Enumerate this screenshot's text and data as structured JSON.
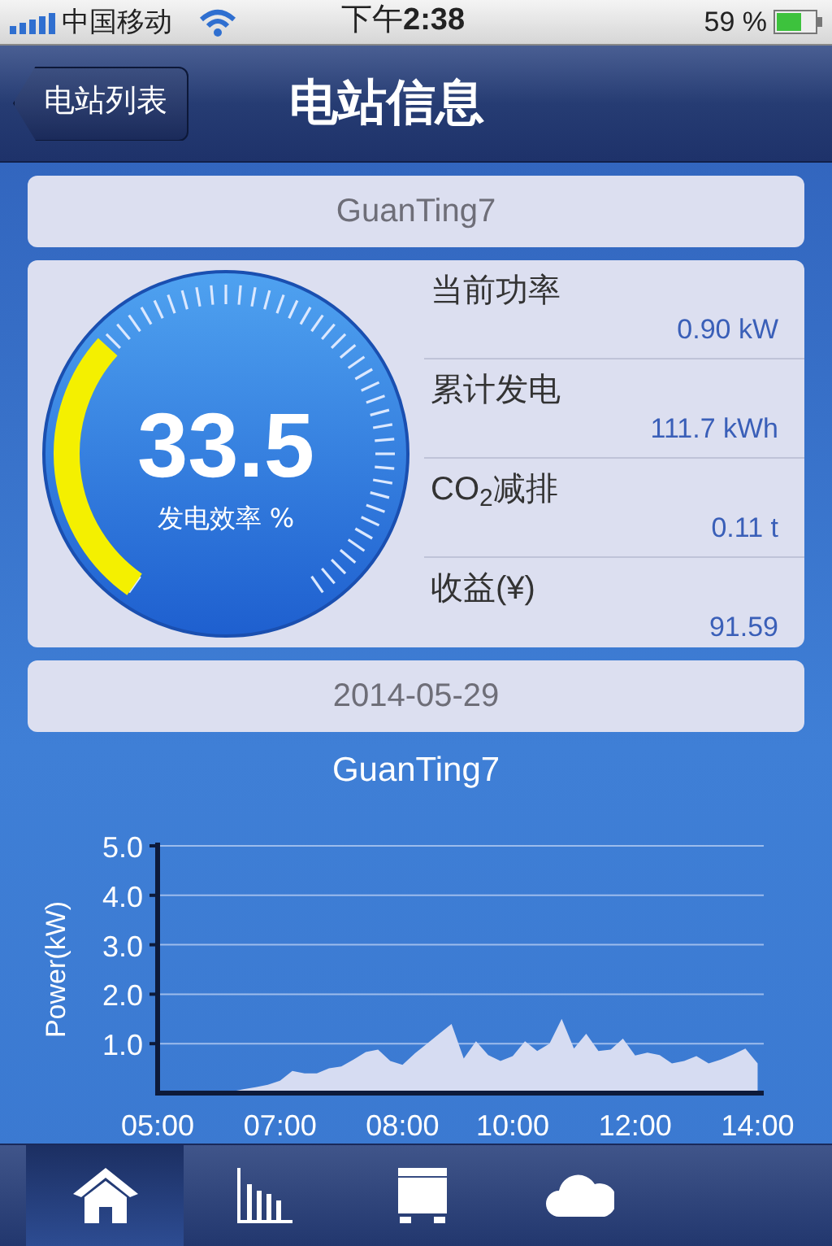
{
  "status_bar": {
    "carrier": "中国移动",
    "time": "下午**2:38**",
    "battery": "59 %"
  },
  "nav_bar": {
    "back": "电站列表",
    "title": "电站信息"
  },
  "station_name": "GuanTing7",
  "gauge": {
    "value": "33.5",
    "label": "发电效率 %"
  },
  "stats": [
    {
      "label": "当前功率",
      "value": "0.90 kW"
    },
    {
      "label": "累计发电",
      "value": "111.7 kWh"
    },
    {
      "label": "CO$_{2}$减排",
      "value": "0.11 t"
    },
    {
      "label": "收益(¥)",
      "value": "91.59"
    }
  ],
  "date": "2014-05-29",
  "chart": {
    "chart_data": {
      "type": "area",
      "title": "GuanTing7",
      "ylabel": "Power(kW)",
      "grid": true,
      "ylim": [
        0,
        5
      ],
      "yticks": [
        {
          "value": 1,
          "label": "1.0"
        },
        {
          "value": 2,
          "label": "2.0"
        },
        {
          "value": 3,
          "label": "3.0"
        },
        {
          "value": 4,
          "label": "4.0"
        },
        {
          "value": 5,
          "label": "5.0"
        }
      ],
      "categories": [
        "05:00",
        null,
        null,
        null,
        null,
        null,
        null,
        null,
        null,
        null,
        "07:00",
        null,
        null,
        null,
        null,
        null,
        null,
        null,
        null,
        null,
        "08:00",
        null,
        null,
        null,
        null,
        null,
        null,
        null,
        null,
        "10:00",
        null,
        null,
        null,
        null,
        null,
        null,
        null,
        null,
        null,
        "12:00",
        null,
        null,
        null,
        null,
        null,
        null,
        null,
        null,
        null,
        "14:00"
      ],
      "series": [
        {
          "color": "#d6dcf2",
          "values": [
            0,
            0,
            0,
            0,
            0,
            0,
            0.03,
            0.08,
            0.12,
            0.17,
            0.25,
            0.45,
            0.4,
            0.4,
            0.5,
            0.54,
            0.68,
            0.83,
            0.88,
            0.65,
            0.57,
            0.8,
            1.0,
            1.2,
            1.4,
            0.7,
            1.05,
            0.77,
            0.65,
            0.75,
            1.05,
            0.85,
            1.0,
            1.5,
            0.9,
            1.2,
            0.85,
            0.88,
            1.1,
            0.76,
            0.82,
            0.77,
            0.6,
            0.65,
            0.75,
            0.6,
            0.68,
            0.78,
            0.9,
            0.6
          ]
        }
      ]
    }
  },
  "tab_bar": [
    {
      "kind": "home",
      "selected": true
    },
    {
      "kind": "chart",
      "selected": false
    },
    {
      "kind": "device",
      "selected": false
    },
    {
      "kind": "cloud",
      "selected": false
    }
  ]
}
